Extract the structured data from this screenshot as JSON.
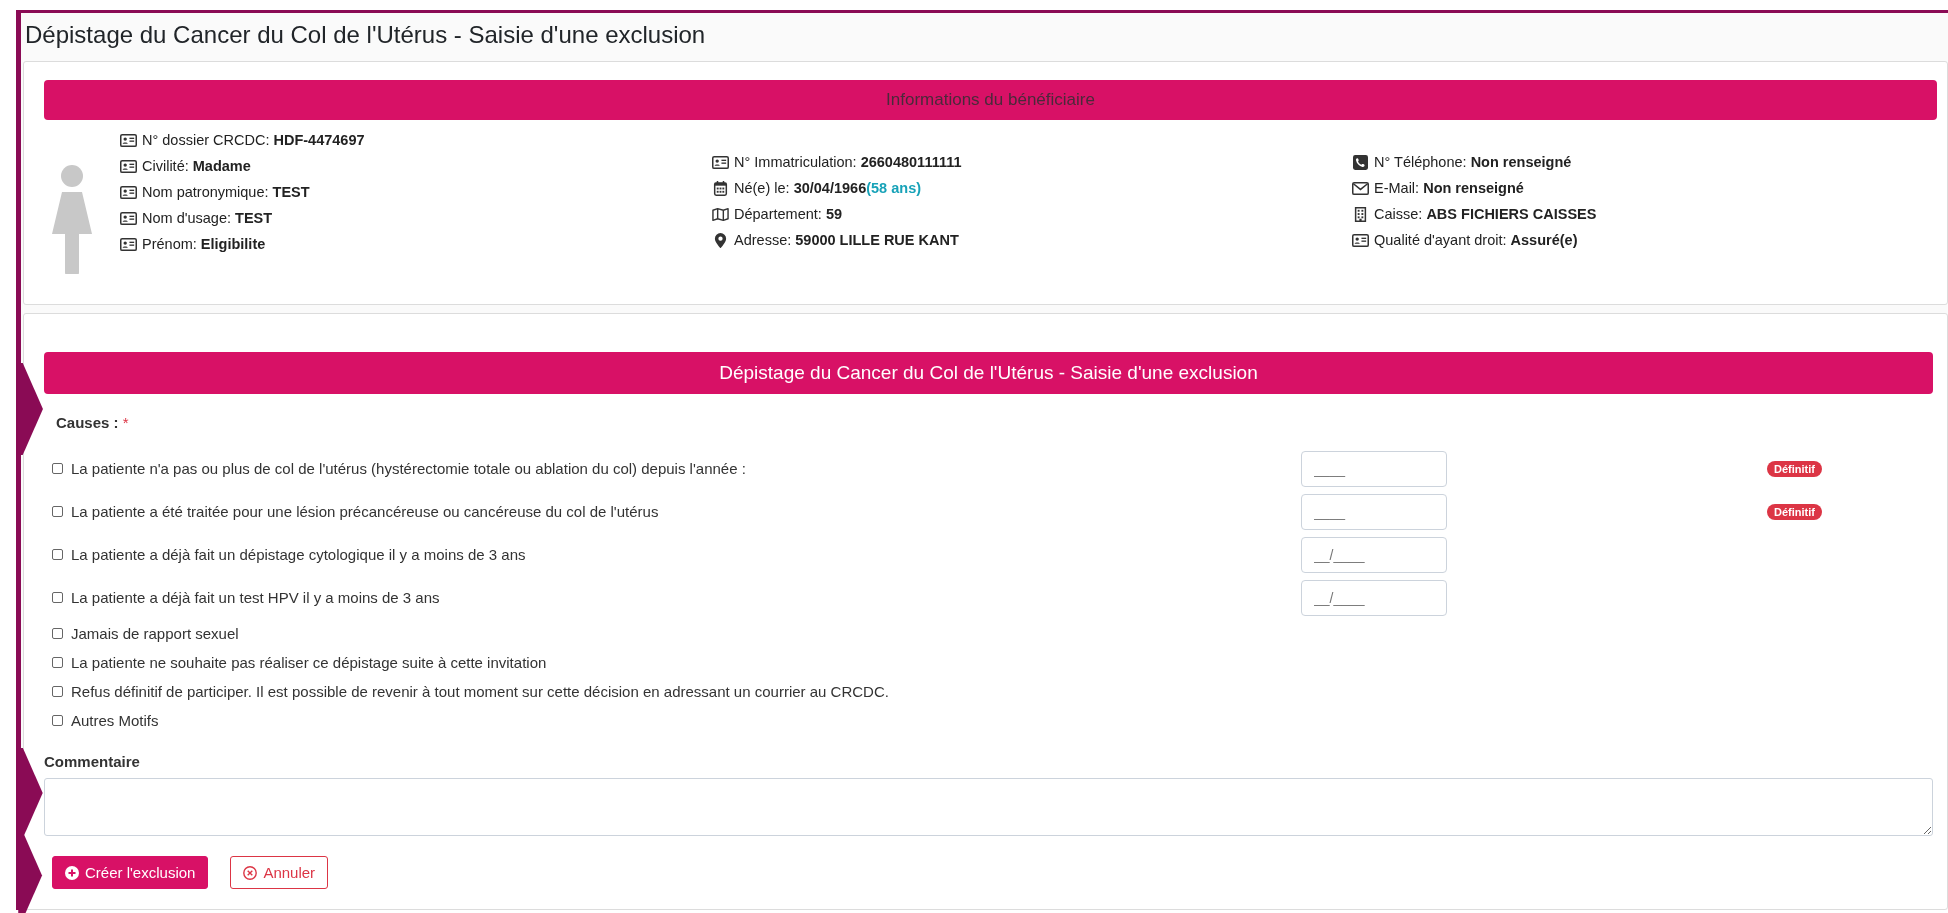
{
  "page_title": "Dépistage du Cancer du Col de l'Utérus - Saisie d'une exclusion",
  "beneficiary": {
    "header": "Informations du bénéficiaire",
    "columns": [
      [
        {
          "kind": "card",
          "label": "N° dossier CRCDC:",
          "value": "HDF-4474697"
        },
        {
          "kind": "card",
          "label": "Civilité:",
          "value": "Madame"
        },
        {
          "kind": "card",
          "label": "Nom patronymique:",
          "value": "TEST"
        },
        {
          "kind": "card",
          "label": "Nom d'usage:",
          "value": "TEST"
        },
        {
          "kind": "card",
          "label": "Prénom:",
          "value": "Eligibilite"
        }
      ],
      [
        {
          "kind": "card",
          "label": "N° Immatriculation:",
          "value": "2660480111111"
        },
        {
          "kind": "date",
          "label": "Né(e) le:",
          "value": "30/04/1966",
          "note": "(58 ans)"
        },
        {
          "kind": "region",
          "label": "Département:",
          "value": "59"
        },
        {
          "kind": "address",
          "label": "Adresse:",
          "value": "59000 LILLE RUE KANT"
        }
      ],
      [
        {
          "kind": "phone",
          "label": "N° Téléphone:",
          "value": "Non renseigné"
        },
        {
          "kind": "email",
          "label": "E-Mail:",
          "value": "Non renseigné"
        },
        {
          "kind": "fund",
          "label": "Caisse:",
          "value": "ABS FICHIERS CAISSES"
        },
        {
          "kind": "card",
          "label": "Qualité d'ayant droit:",
          "value": "Assuré(e)"
        }
      ]
    ]
  },
  "form": {
    "header": "Dépistage du Cancer du Col de l'Utérus - Saisie d'une exclusion",
    "causes_label": "Causes :",
    "required_mark": "*",
    "causes": [
      {
        "label": "La patiente n'a pas ou plus de col de l'utérus (hystérectomie totale ou ablation du col) depuis l'année :",
        "checked": false,
        "field": {
          "placeholder": "____"
        },
        "badge": "Définitif"
      },
      {
        "label": "La patiente a été traitée pour une lésion précancéreuse ou cancéreuse du col de l'utérus",
        "checked": false,
        "field": {
          "placeholder": "____"
        },
        "badge": "Définitif"
      },
      {
        "label": "La patiente a déjà fait un dépistage cytologique il y a moins de 3 ans",
        "checked": false,
        "field": {
          "placeholder": "__/____"
        }
      },
      {
        "label": "La patiente a déjà fait un test HPV il y a moins de 3 ans",
        "checked": false,
        "field": {
          "placeholder": "__/____"
        }
      },
      {
        "label": "Jamais de rapport sexuel",
        "checked": false
      },
      {
        "label": "La patiente ne souhaite pas réaliser ce dépistage suite à cette invitation",
        "checked": false
      },
      {
        "label": "Refus définitif de participer. Il est possible de revenir à tout moment sur cette décision en adressant un courrier au CRCDC.",
        "checked": false
      },
      {
        "label": "Autres Motifs",
        "checked": false
      }
    ],
    "comment_label": "Commentaire",
    "buttons": [
      {
        "kind": "primary",
        "label": "Créer l'exclusion"
      },
      {
        "kind": "cancel",
        "label": "Annuler"
      }
    ]
  }
}
